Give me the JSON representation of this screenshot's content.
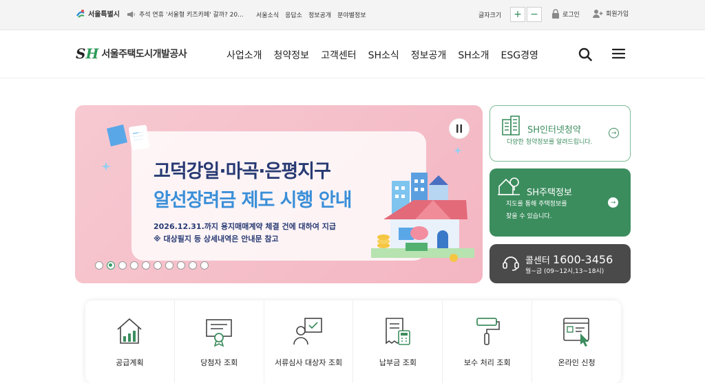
{
  "topbar": {
    "seoul_logo": "서울특별시",
    "notice": "추석 연휴 '서울형 키즈카페' 갈까? 20...",
    "links": [
      "서울소식",
      "응답소",
      "정보공개",
      "분야별정보"
    ],
    "font_size_label": "글자크기",
    "font_plus": "+",
    "font_minus": "−",
    "login": "로그인",
    "join": "회원가입"
  },
  "header": {
    "logo_mark_s": "S",
    "logo_mark_h": "H",
    "logo_name": "서울주택도시개발공사",
    "nav": [
      "사업소개",
      "청약정보",
      "고객센터",
      "SH소식",
      "정보공개",
      "SH소개",
      "ESG경영"
    ]
  },
  "hero": {
    "title1": "고덕강일·마곡·은평지구",
    "title2": "알선장려금 제도 시행 안내",
    "sub1": "2026.12.31.까지 용지매매계약 체결 건에 대하여 지급",
    "sub2": "※ 대상필지 등 상세내역은 안내문 참고",
    "slide_count": 10,
    "active_slide": 2
  },
  "quick": {
    "card1_title": "SH인터넷청약",
    "card1_sub": "다양한 청약정보를 알려드립니다.",
    "card2_title": "SH주택정보",
    "card2_sub1": "지도를 통해 주택정보를",
    "card2_sub2": "찾을 수 있습니다.",
    "card3_title": "콜센터",
    "card3_number": "1600-3456",
    "card3_hours": "월~금 (09~12시,13~18시)"
  },
  "services": [
    {
      "label": "공급계획",
      "icon": "house-chart-icon"
    },
    {
      "label": "당첨자 조회",
      "icon": "certificate-icon"
    },
    {
      "label": "서류심사 대상자 조회",
      "icon": "person-document-icon"
    },
    {
      "label": "납부금 조회",
      "icon": "receipt-calculator-icon"
    },
    {
      "label": "보수 처리 조회",
      "icon": "paint-roller-icon"
    },
    {
      "label": "온라인 신청",
      "icon": "online-form-icon"
    }
  ],
  "colors": {
    "brand_green": "#3c8d5e",
    "navy": "#273a73",
    "blue": "#3a8fd8",
    "hero_pink": "#f3b6c2"
  }
}
